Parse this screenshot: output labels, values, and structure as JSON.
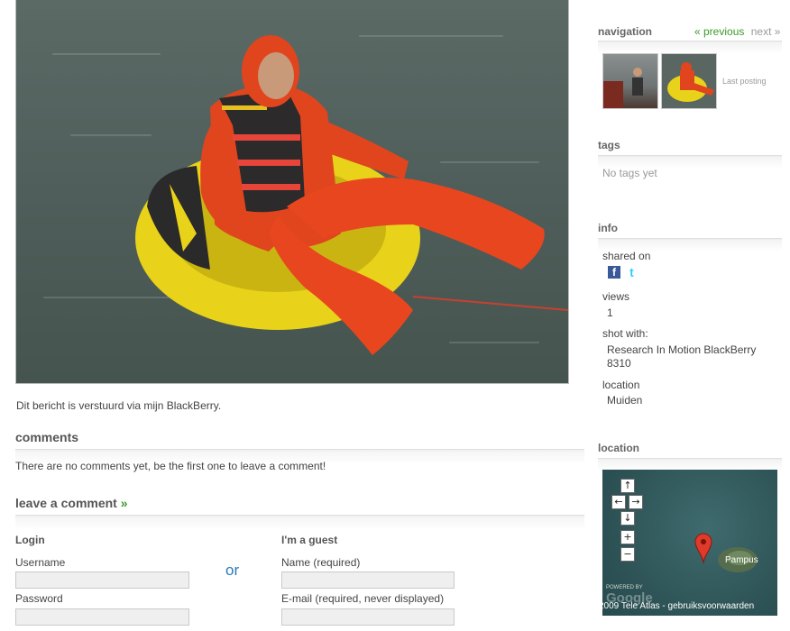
{
  "post": {
    "caption": "Dit bericht is verstuurd via mijn BlackBerry."
  },
  "comments": {
    "title": "comments",
    "empty_text": "There are no comments yet, be the first one to leave a comment!"
  },
  "leave_comment": {
    "title": "leave a comment",
    "arrow": "»",
    "login_title": "Login",
    "username_label": "Username",
    "password_label": "Password",
    "or_text": "or",
    "guest_title": "I'm a guest",
    "name_label": "Name (required)",
    "email_label": "E-mail (required, never displayed)"
  },
  "sidebar": {
    "navigation": {
      "title": "navigation",
      "previous": "« previous",
      "next": "next »",
      "last_posting": "Last posting"
    },
    "tags": {
      "title": "tags",
      "empty": "No tags yet"
    },
    "info": {
      "title": "info",
      "shared_on_label": "shared on",
      "views_label": "views",
      "views_value": "1",
      "shot_with_label": "shot with:",
      "shot_with_value": "Research In Motion BlackBerry 8310",
      "location_label": "location",
      "location_value": "Muiden"
    },
    "location_map": {
      "title": "location",
      "place_label": "Pampus",
      "attribution": "2009 Tele Atlas - gebruiksvoorwaarden",
      "powered_by": "POWERED BY",
      "google": "Google"
    }
  },
  "colors": {
    "accent_link": "#3a9a2a",
    "or_blue": "#2a7ab8",
    "facebook": "#3b5998",
    "twitter": "#33ccff",
    "map_marker": "#e03a2a"
  }
}
